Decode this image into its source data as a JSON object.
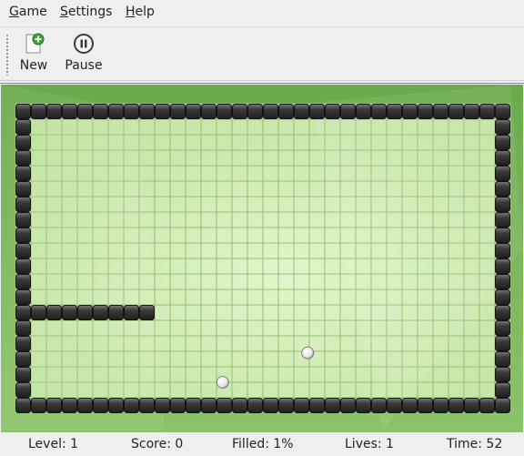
{
  "menu": {
    "game": {
      "first": "G",
      "rest": "ame"
    },
    "settings": {
      "first": "S",
      "rest": "ettings"
    },
    "help": {
      "first": "H",
      "rest": "elp"
    }
  },
  "toolbar": {
    "new_label": "New",
    "new_icon": "new-game-icon",
    "pause_label": "Pause",
    "pause_icon": "pause-icon"
  },
  "board": {
    "cols": 32,
    "rows": 20,
    "wall_rows": [
      {
        "row": 0,
        "from": 0,
        "to": 31
      },
      {
        "row": 19,
        "from": 0,
        "to": 31
      },
      {
        "row": 13,
        "from": 0,
        "to": 8
      }
    ],
    "wall_cols": [
      {
        "col": 0,
        "from": 0,
        "to": 19
      },
      {
        "col": 31,
        "from": 0,
        "to": 19
      }
    ],
    "balls": [
      {
        "col": 18.9,
        "row": 16.1
      },
      {
        "col": 13.4,
        "row": 18.0
      }
    ],
    "colors": {
      "background": "#74b255",
      "field": "#cfeab0",
      "grid_line": "#8dc46c",
      "wall": "#2c2c2c",
      "wall_highlight": "#707070",
      "ball": "#ffffff"
    }
  },
  "status": {
    "level": "Level: 1",
    "score": "Score: 0",
    "filled": "Filled: 1%",
    "lives": "Lives: 1",
    "time": "Time: 52"
  }
}
